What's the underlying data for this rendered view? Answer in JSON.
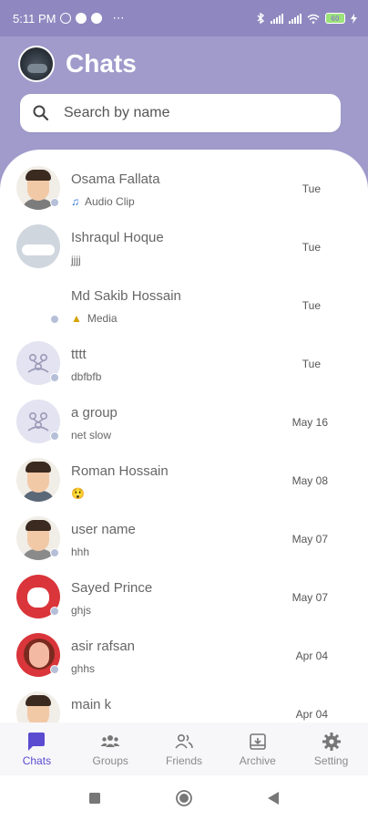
{
  "status_bar": {
    "time": "5:11 PM",
    "more": "⋯",
    "battery": "60",
    "signal_label": "atl"
  },
  "header": {
    "title": "Chats"
  },
  "search": {
    "placeholder": "Search by name"
  },
  "chats": [
    {
      "name": "Osama Fallata",
      "preview": "Audio Clip",
      "preview_icon": "music-note-icon",
      "time": "Tue",
      "avatar": "person"
    },
    {
      "name": "Ishraqul Hoque",
      "preview": "jjjj",
      "time": "Tue",
      "avatar": "car"
    },
    {
      "name": "Md Sakib Hossain",
      "preview": "Media",
      "preview_icon": "image-icon",
      "time": "Tue",
      "avatar": "blank"
    },
    {
      "name": "tttt",
      "preview": "dbfbfb",
      "time": "Tue",
      "avatar": "group"
    },
    {
      "name": "a group",
      "preview": "net slow",
      "time": "May 16",
      "avatar": "group"
    },
    {
      "name": "Roman Hossain",
      "preview": "😲",
      "time": "May 08",
      "avatar": "person"
    },
    {
      "name": "user name",
      "preview": "hhh",
      "time": "May 07",
      "avatar": "person"
    },
    {
      "name": "Sayed Prince",
      "preview": "ghjs",
      "time": "May 07",
      "avatar": "cat"
    },
    {
      "name": "asir rafsan",
      "preview": "ghhs",
      "time": "Apr 04",
      "avatar": "woman"
    },
    {
      "name": "main k",
      "preview": "",
      "time": "Apr 04",
      "avatar": "person"
    }
  ],
  "bottom_nav": [
    {
      "label": "Chats",
      "icon": "chat-bubble-icon",
      "active": true
    },
    {
      "label": "Groups",
      "icon": "groups-icon",
      "active": false
    },
    {
      "label": "Friends",
      "icon": "friends-icon",
      "active": false
    },
    {
      "label": "Archive",
      "icon": "archive-icon",
      "active": false
    },
    {
      "label": "Setting",
      "icon": "gear-icon",
      "active": false
    }
  ],
  "colors": {
    "accent": "#5b4bd1",
    "header_bg": "#a09bcb",
    "status_bg": "#8f88c0",
    "online_dot": "#b6bfd8"
  }
}
